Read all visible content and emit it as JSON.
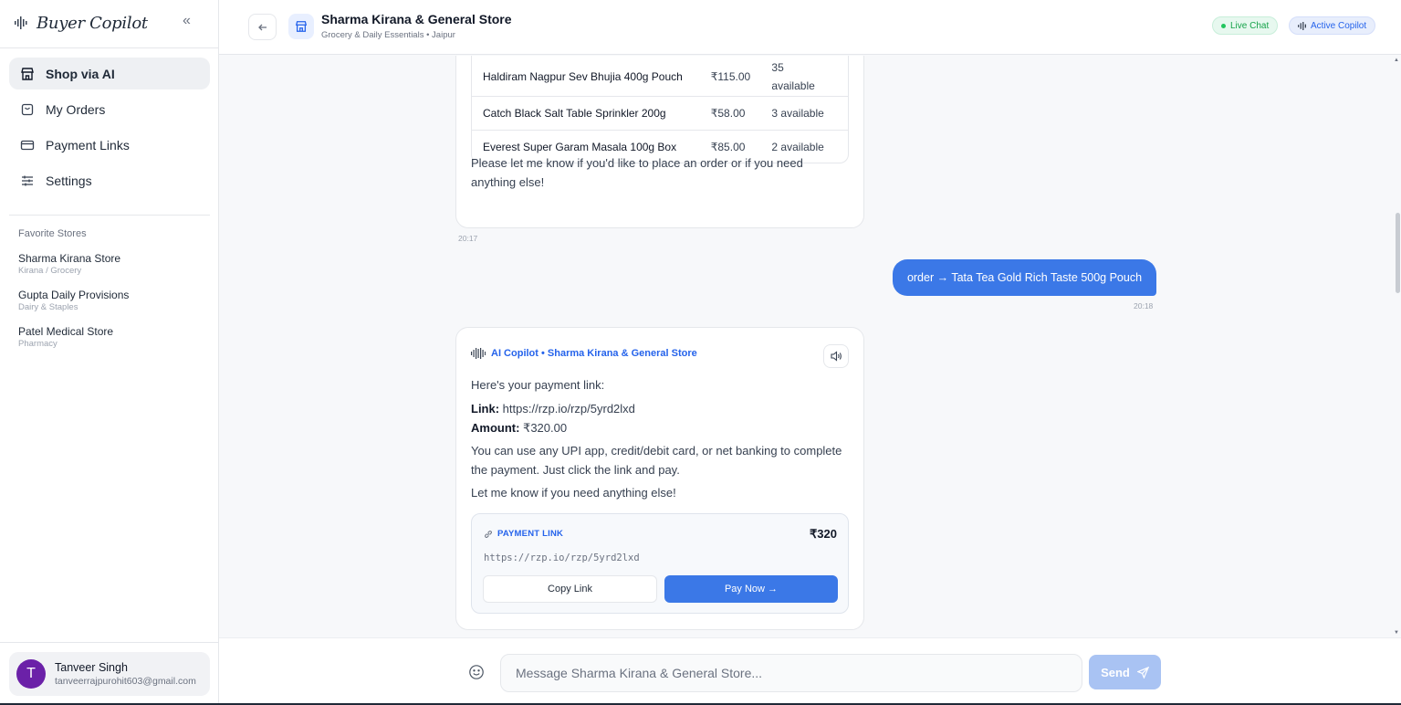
{
  "sidebar": {
    "brand": "Buyer Copilot",
    "collapse_icon": "chevrons-left-icon",
    "nav": [
      {
        "label": "Shop via AI",
        "icon": "storefront-icon",
        "active": true
      },
      {
        "label": "My Orders",
        "icon": "shopping-bag-icon",
        "active": false
      },
      {
        "label": "Payment Links",
        "icon": "credit-card-icon",
        "active": false
      },
      {
        "label": "Settings",
        "icon": "sliders-icon",
        "active": false
      }
    ],
    "favorites_title": "Favorite Stores",
    "favorites": [
      {
        "name": "Sharma Kirana Store",
        "category": "Kirana / Grocery"
      },
      {
        "name": "Gupta Daily Provisions",
        "category": "Dairy & Staples"
      },
      {
        "name": "Patel Medical Store",
        "category": "Pharmacy"
      }
    ],
    "user": {
      "initial": "T",
      "name": "Tanveer Singh",
      "email": "tanveerrajpurohit603@gmail.com",
      "avatar_color": "#6b21a8"
    }
  },
  "header": {
    "store_name": "Sharma Kirana & General Store",
    "store_subtitle": "Grocery & Daily Essentials • Jaipur",
    "badge_live": "Live Chat",
    "badge_copilot": "Active Copilot"
  },
  "chat": {
    "inventory_rows": [
      {
        "name": "Haldiram Nagpur Sev Bhujia 400g Pouch",
        "price": "₹115.00",
        "stock_line1": "35",
        "stock_line2": "available"
      },
      {
        "name": "Catch Black Salt Table Sprinkler 200g",
        "price": "₹58.00",
        "stock_line1": "3 available",
        "stock_line2": ""
      },
      {
        "name": "Everest Super Garam Masala 100g Box",
        "price": "₹85.00",
        "stock_line1": "2 available",
        "stock_line2": ""
      }
    ],
    "msg1_closing": "Please let me know if you'd like to place an order or if you need anything else!",
    "msg1_time": "20:17",
    "user_msg": "order → Tata Tea Gold Rich Taste 500g Pouch",
    "user_time": "20:18",
    "msg2": {
      "header": "AI Copilot • Sharma Kirana & General Store",
      "intro": "Here's your payment link:",
      "link_key": "Link:",
      "link_value": " https://rzp.io/rzp/5yrd2lxd",
      "amount_key": "Amount:",
      "amount_value": " ₹320.00",
      "body": "You can use any UPI app, credit/debit card, or net banking to complete the payment. Just click the link and pay.",
      "closing": "Let me know if you need anything else!",
      "card": {
        "label": "PAYMENT LINK",
        "amount": "₹320",
        "url": "https://rzp.io/rzp/5yrd2lxd",
        "copy_label": "Copy Link",
        "pay_label": "Pay Now →"
      }
    }
  },
  "composer": {
    "placeholder": "Message Sharma Kirana & General Store...",
    "send_label": "Send"
  },
  "colors": {
    "accent": "#3b78e7",
    "live": "#16a34a",
    "brand_text": "#1f2937"
  }
}
